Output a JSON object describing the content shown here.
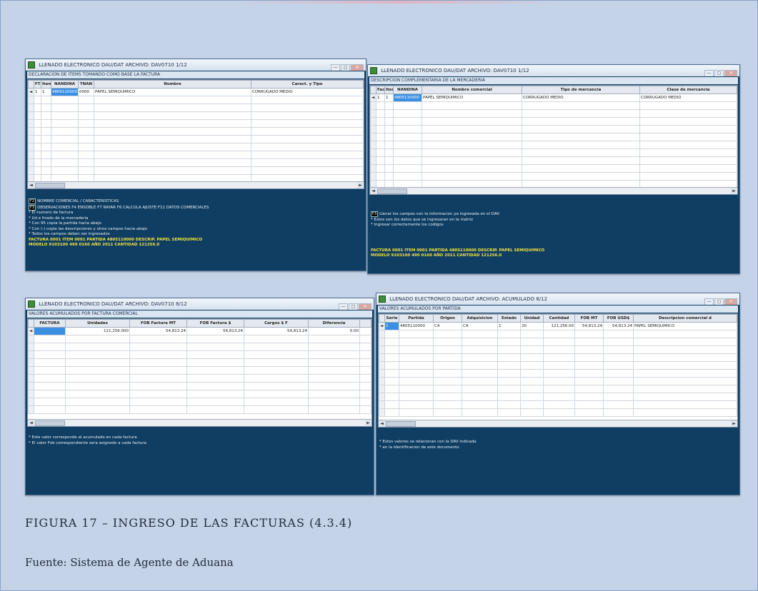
{
  "caption": {
    "figure": "FIGURA 17 – INGRESO DE LAS FACTURAS (4.3.4)",
    "source": "Fuente: Sistema de Agente de Aduana"
  },
  "windows": [
    {
      "title": "LLENADO ELECTRONICO DAU/DAT   ARCHIVO: DAV0710 1/12",
      "heading": "DECLARACION DE ITEMS TOMANDO COMO BASE LA FACTURA",
      "columns": [
        "FT",
        "Item",
        "NANDINA",
        "TNAN",
        "Nombre",
        "Caract. y Tipo"
      ],
      "rows": [
        [
          "1",
          "1",
          "4805110000",
          "0000",
          "PAPEL SEMIQUIMICO",
          "CORRUGADO MEDIO"
        ]
      ],
      "info": [
        {
          "key": "F2",
          "text": "NOMBRE COMERCIAL / CARACTERISTICAS"
        },
        {
          "key": "F3",
          "text": "OBSERVACIONES   F4   ENSOBLE   F7   RAYAR   F6   CALCULA AJUSTE   F11   DATOS COMERCIALES"
        },
        {
          "text": "* El numero de factura"
        },
        {
          "text": "* Ud e ltrado de la mercaderia"
        },
        {
          "text": "* Con 95 copia la partida hacia abajo"
        },
        {
          "text": "* Con (-) copia las descripciones y otros campos hacia abajo"
        },
        {
          "text": "* Todos los campos deben ser ingresados"
        },
        {
          "text": "FACTURA 0001   ITEM 0001   PARTIDA 4805110000 DESCRIP. PAPEL SEMIQUIMICO",
          "highlight": true
        },
        {
          "text": "MODELO 9103100 490 0160    AÑO 2011 CANTIDAD 121256.0",
          "highlight": true
        }
      ]
    },
    {
      "title": "LLENADO ELECTRONICO DAU/DAT   ARCHIVO: DAV0710 1/12",
      "heading": "DESCRIPCION COMPLEMENTARIA DE LA MERCADERIA",
      "columns": [
        "Fact",
        "Item",
        "NANDINA",
        "Nombre comercial",
        "Tipo de mercancia",
        "Clase de mercancia"
      ],
      "rows": [
        [
          "1",
          "1",
          "4805110000",
          "PAPEL SEMIQUIMICO",
          "CORRUGADO MEDIO",
          "CORRUGADO MEDIO"
        ]
      ],
      "info": [
        {
          "key": "F3",
          "text": "Llenar los campos con la informacion ya ingresada en el DAV"
        },
        {
          "text": "* Estos son los datos que se ingresaran en la matriz"
        },
        {
          "text": "* Ingresar correctamente los codigos"
        },
        {
          "text": "FACTURA 0001   ITEM 0001   PARTIDA 4805110000 DESCRIP. PAPEL SEMIQUIMICO",
          "highlight": true
        },
        {
          "text": "MODELO 9103100 490 0160    AÑO 2011 CANTIDAD 121256.0",
          "highlight": true
        }
      ]
    },
    {
      "title": "LLENADO ELECTRONICO DAU/DAT   ARCHIVO: DAV0710 8/12",
      "heading": "VALORES ACUMULADOS POR FACTURA COMERCIAL",
      "columns": [
        "FACTURA",
        "Unidades",
        "FOB Factura MT",
        "FOB Factura $",
        "Cargos $ F",
        "Diferencia"
      ],
      "rows": [
        [
          "",
          "121,256.000",
          "54,813.24",
          "54,813.24",
          "54,813.24",
          "0.00"
        ]
      ],
      "info": [
        {
          "text": "* Este valor corresponde al acumulado en cada factura"
        },
        {
          "text": "* El valor Fob correspondiente sera asignado a cada factura"
        }
      ]
    },
    {
      "title": "LLENADO ELECTRONICO DAU/DAT   ARCHIVO: ACUMULADO 8/12",
      "heading": "VALORES ACUMULADOS POR PARTIDA",
      "columns": [
        "Serie",
        "Partida",
        "Origen",
        "Adquisicion",
        "Estado",
        "Unidad",
        "Cantidad",
        "FOB MT",
        "FOB USD$",
        "Descripcion comercial d"
      ],
      "rows": [
        [
          "1",
          "4805110000",
          "CA",
          "CA",
          "1",
          "20",
          "121,256.00",
          "54,813.24",
          "54,813.24",
          "PAPEL SEMIQUIMICO"
        ]
      ],
      "info": [
        {
          "text": "* Estos valores se relacionan con la DAV indicada"
        },
        {
          "text": "* en la identificacion de este documento"
        }
      ]
    }
  ],
  "window_buttons": {
    "minimize": "—",
    "maximize": "□",
    "close": "✕"
  }
}
